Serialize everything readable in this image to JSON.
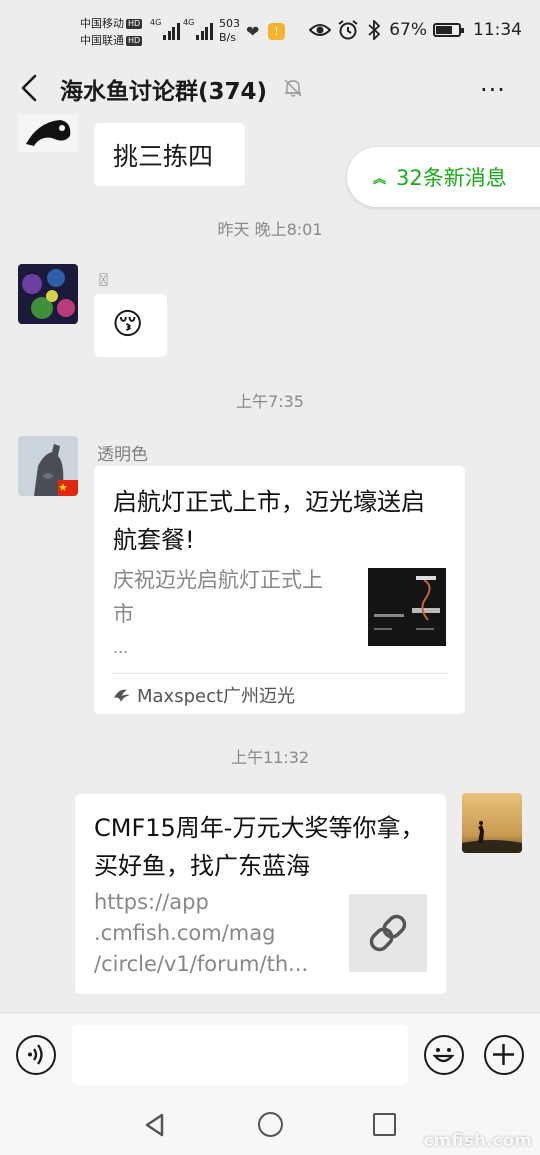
{
  "status_bar": {
    "carrier_1": "中国移动",
    "carrier_2": "中国联通",
    "hd_badge": "HD",
    "net_type_1": "4G",
    "net_type_2": "4G",
    "speed_value": "503",
    "speed_unit": "B/s",
    "battery_percent": "67%",
    "time": "11:34",
    "icons": [
      "heartbeat-icon",
      "app-notification-icon",
      "eye-icon",
      "alarm-icon",
      "bluetooth-icon",
      "battery-icon"
    ]
  },
  "header": {
    "title": "海水鱼讨论群(374)",
    "more": "···"
  },
  "new_messages": {
    "label": "32条新消息",
    "color": "#1aad19"
  },
  "messages": {
    "m1": {
      "text": "挑三拣四"
    },
    "ts1": "昨天 晚上8:01",
    "m2": {
      "sender": "〿",
      "emoji": "😚"
    },
    "ts2": "上午7:35",
    "m3": {
      "sender": "透明色",
      "title": "启航灯正式上市，迈光壕送启航套餐!",
      "desc_line1": "庆祝迈光启航灯正式上",
      "desc_line2": "市",
      "desc_line3": "...",
      "source": "Maxspect广州迈光"
    },
    "ts3": "上午11:32",
    "m4": {
      "title": "CMF15周年-万元大奖等你拿，买好鱼，找广东蓝海",
      "url_line1": "https://app",
      "url_line2": ".cmfish.com/mag",
      "url_line3": "/circle/v1/forum/th..."
    }
  },
  "watermark": "cmfish.com"
}
